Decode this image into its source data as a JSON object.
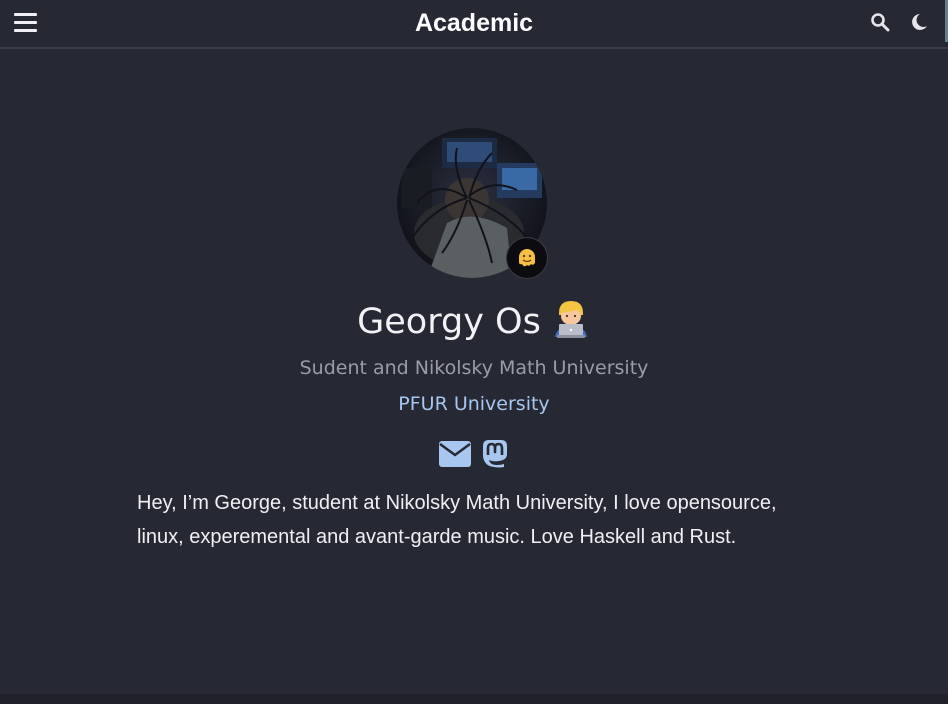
{
  "navbar": {
    "brand": "Academic",
    "menu_icon": "hamburger-menu-icon",
    "search_icon": "search-icon",
    "theme_icon": "moon-icon"
  },
  "profile": {
    "avatar_icon": "profile-photo",
    "status_emoji": "🫠",
    "name": "Georgy Os",
    "name_emoji": "🧑‍💻",
    "role": "Sudent and Nikolsky Math University",
    "organization": "PFUR University",
    "social": [
      {
        "icon": "envelope-icon"
      },
      {
        "icon": "mastodon-icon"
      }
    ],
    "bio": "Hey, I’m George, student at Nikolsky Math University, I love opensource, linux, experemental and avant-garde music. Love Haskell and Rust."
  },
  "colors": {
    "background": "#262833",
    "link": "#a7c6f0",
    "muted_text": "#9a9ca6"
  }
}
